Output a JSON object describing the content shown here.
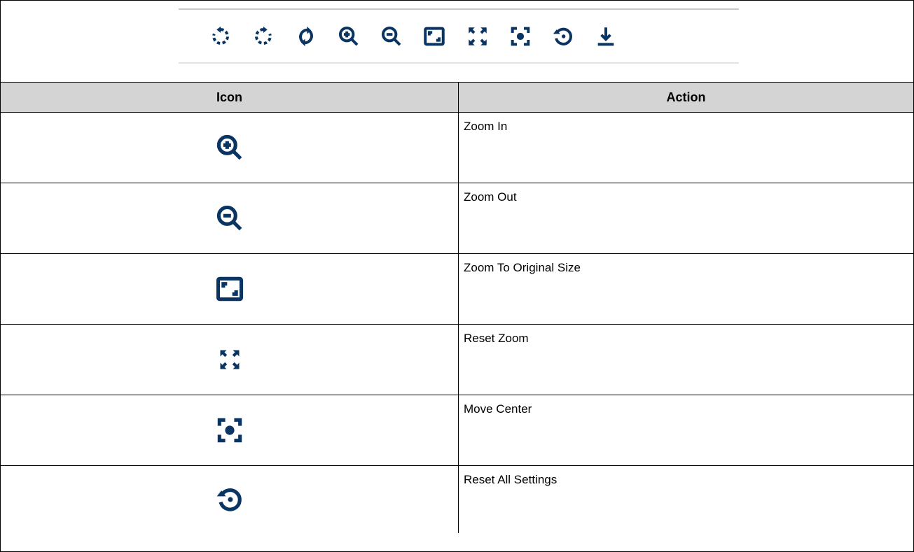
{
  "toolbar": {
    "icons": [
      "rotate-counterclockwise-icon",
      "rotate-clockwise-icon",
      "flip-icon",
      "zoom-in-icon",
      "zoom-out-icon",
      "original-size-icon",
      "reset-zoom-icon",
      "move-center-icon",
      "reset-all-icon",
      "download-icon"
    ]
  },
  "colors": {
    "icon": "#0a3562",
    "header_bg": "#d4d4d4",
    "border": "#000000"
  },
  "table": {
    "headers": {
      "icon": "Icon",
      "action": "Action"
    },
    "rows": [
      {
        "icon": "zoom-in-icon",
        "action": "Zoom In"
      },
      {
        "icon": "zoom-out-icon",
        "action": "Zoom Out"
      },
      {
        "icon": "original-size-icon",
        "action": "Zoom To Original Size"
      },
      {
        "icon": "reset-zoom-icon",
        "action": "Reset Zoom"
      },
      {
        "icon": "move-center-icon",
        "action": "Move Center"
      },
      {
        "icon": "reset-all-icon",
        "action": "Reset All Settings"
      }
    ]
  }
}
